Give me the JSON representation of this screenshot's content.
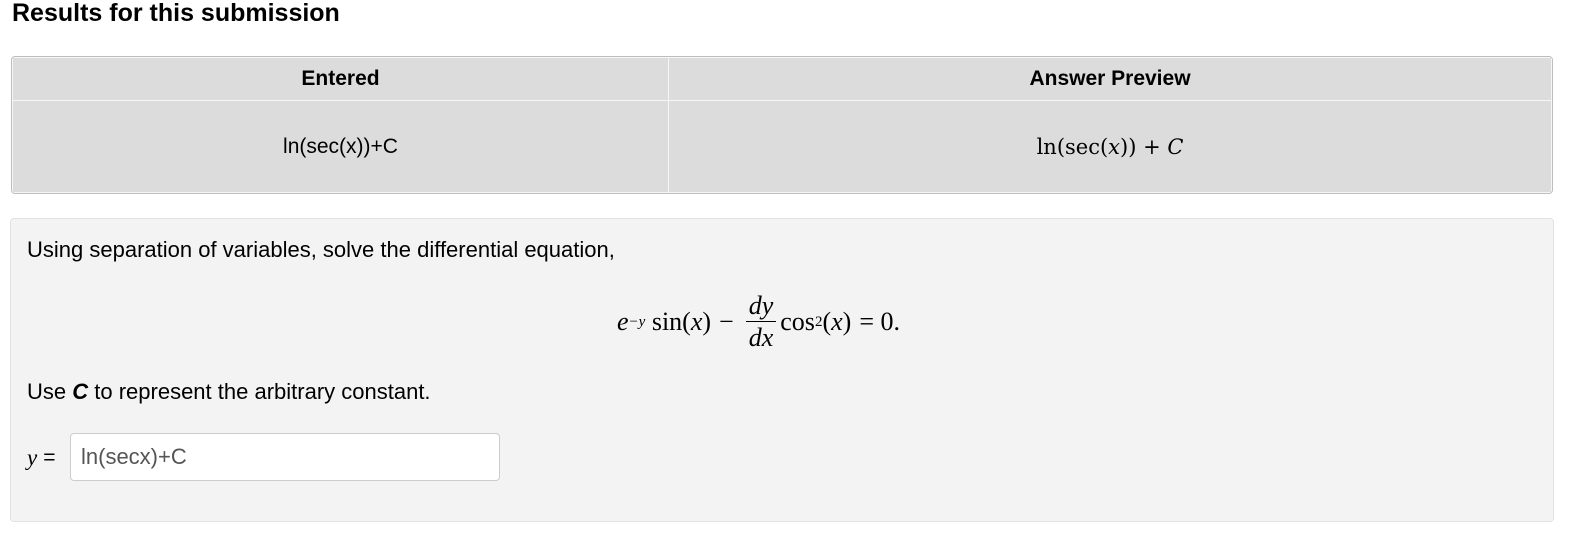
{
  "results_heading": "Results for this submission",
  "table": {
    "headers": [
      "Entered",
      "Answer Preview"
    ],
    "row": {
      "entered": "ln(sec(x))+C",
      "preview": {
        "ln": "ln",
        "open": "(sec(",
        "var_x": "x",
        "close": "))",
        "plus": " + ",
        "var_c": "C"
      }
    }
  },
  "problem": {
    "prompt": "Using separation of variables, solve the differential equation,",
    "equation": {
      "e": "e",
      "exp": "−y",
      "sin": " sin(",
      "x1": "x",
      "sin_close": ")",
      "minus": "−",
      "dy": "dy",
      "dx": "dx",
      "cos": "cos",
      "cos_exp": "2",
      "cos_open": "(",
      "x2": "x",
      "cos_close": ")",
      "equals": "= 0."
    },
    "const_note_prefix": "Use ",
    "const_note_var": "C",
    "const_note_suffix": " to represent the arbitrary constant.",
    "answer_var": "y",
    "answer_eq": "=",
    "answer_value": "ln(secx)+C"
  }
}
